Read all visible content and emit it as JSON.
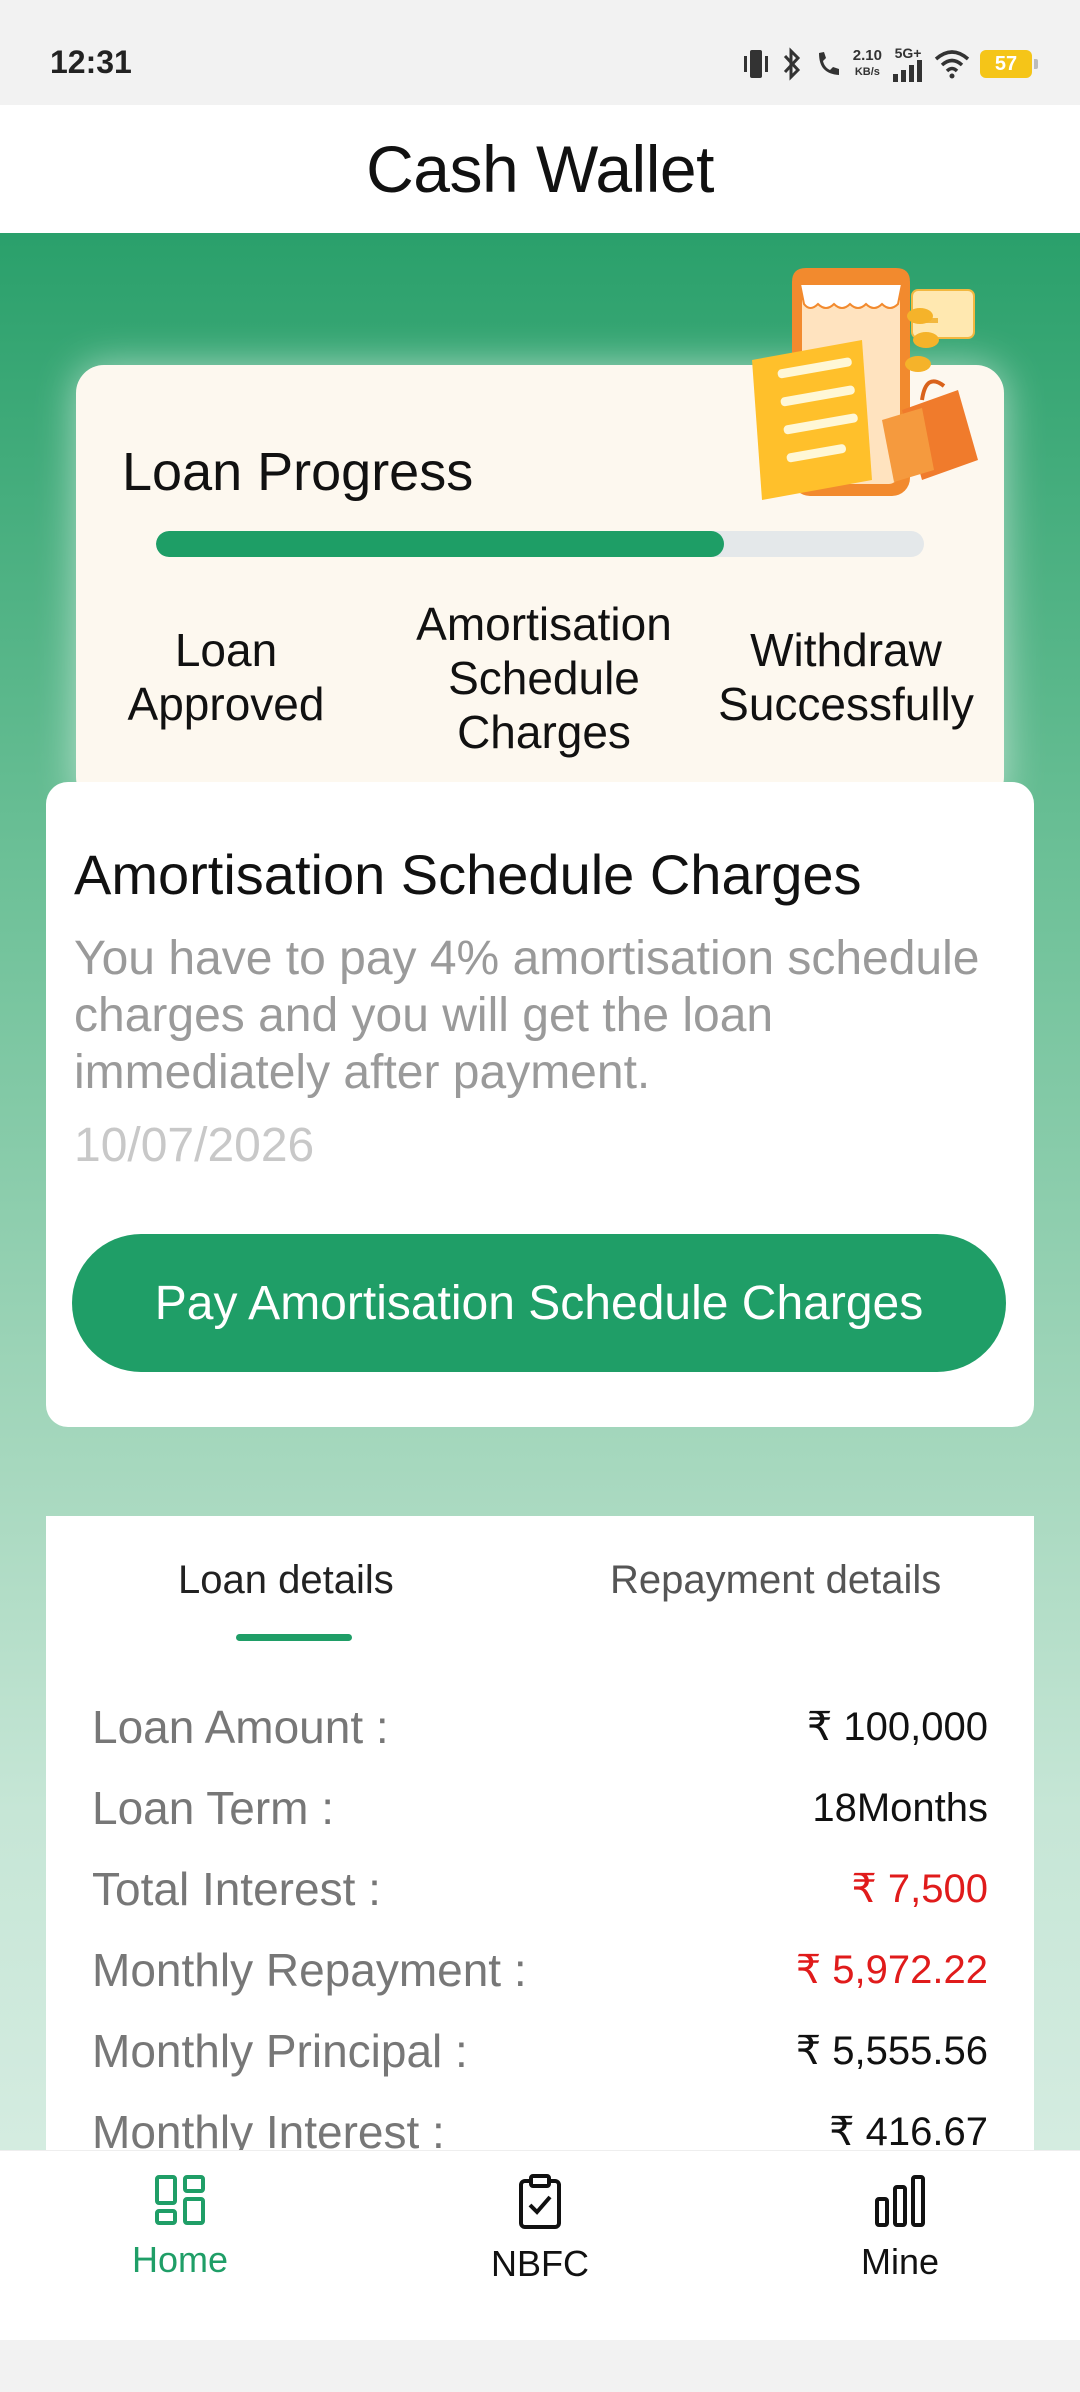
{
  "status_bar": {
    "time": "12:31",
    "net_speed_value": "2.10",
    "net_speed_unit": "KB/s",
    "network": "5G+",
    "battery": "57"
  },
  "header": {
    "title": "Cash Wallet"
  },
  "loan_progress": {
    "title": "Loan Progress",
    "progress_fraction": 0.74,
    "steps": [
      "Loan Approved",
      "Amortisation Schedule Charges",
      "Withdraw Successfully"
    ]
  },
  "charges": {
    "title": "Amortisation Schedule Charges",
    "description": "You have to pay 4% amortisation schedule charges and you will get the loan immediately after payment.",
    "date": "10/07/2026",
    "button_label": "Pay Amortisation Schedule Charges"
  },
  "details": {
    "tabs": [
      "Loan details",
      "Repayment details"
    ],
    "active_tab": 0,
    "rows": [
      {
        "label": "Loan Amount :",
        "value": "₹ 100,000",
        "highlight": false
      },
      {
        "label": "Loan Term :",
        "value": "18Months",
        "highlight": false
      },
      {
        "label": "Total Interest :",
        "value": "₹ 7,500",
        "highlight": true
      },
      {
        "label": "Monthly Repayment :",
        "value": "₹ 5,972.22",
        "highlight": true
      },
      {
        "label": "Monthly Principal :",
        "value": "₹ 5,555.56",
        "highlight": false
      },
      {
        "label": "Monthly Interest :",
        "value": "₹ 416.67",
        "highlight": false
      }
    ]
  },
  "bottom_nav": {
    "items": [
      {
        "label": "Home",
        "icon": "grid-icon",
        "active": true
      },
      {
        "label": "NBFC",
        "icon": "clipboard-check-icon",
        "active": false
      },
      {
        "label": "Mine",
        "icon": "bar-chart-icon",
        "active": false
      }
    ]
  },
  "colors": {
    "accent": "#1f9e67",
    "highlight": "#e01b1b",
    "card_bg": "#fdf8ef"
  }
}
